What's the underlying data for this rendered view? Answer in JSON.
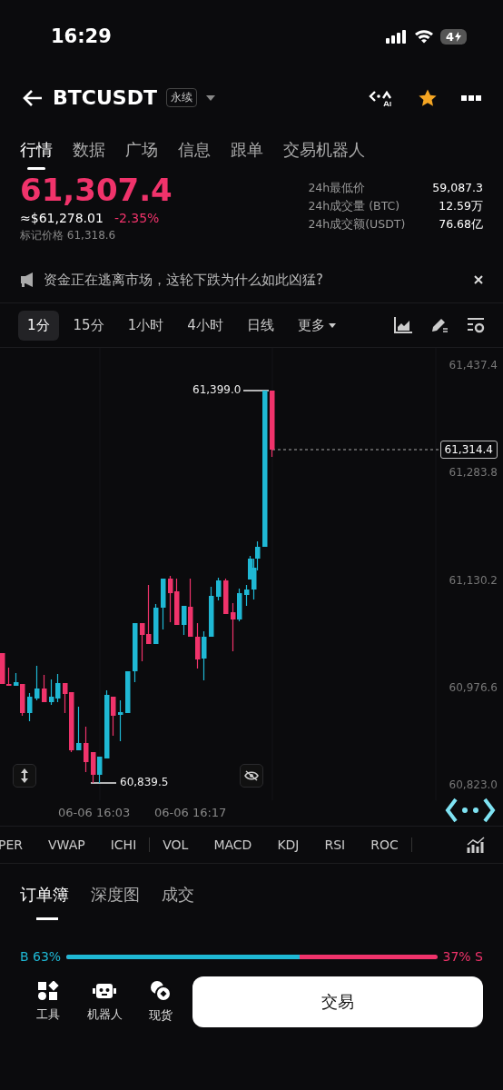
{
  "status_bar": {
    "time": "16:29",
    "battery": "4"
  },
  "header": {
    "symbol": "BTCUSDT",
    "badge": "永续"
  },
  "tabs": [
    {
      "label": "行情",
      "selected": true
    },
    {
      "label": "数据",
      "selected": false
    },
    {
      "label": "广场",
      "selected": false
    },
    {
      "label": "信息",
      "selected": false
    },
    {
      "label": "跟单",
      "selected": false
    },
    {
      "label": "交易机器人",
      "selected": false
    }
  ],
  "ticker": {
    "price": "61,307.4",
    "approx": "≈$61,278.01",
    "change": "-2.35%",
    "mark_price": "标记价格 61,318.6",
    "stats": [
      {
        "label": "24h最低价",
        "value": "59,087.3"
      },
      {
        "label": "24h成交量 (BTC)",
        "value": "12.59万"
      },
      {
        "label": "24h成交额(USDT)",
        "value": "76.68亿"
      }
    ]
  },
  "announcement": {
    "text": "资金正在逃离市场，这轮下跌为什么如此凶猛?"
  },
  "intervals": [
    {
      "label": "1分",
      "selected": true
    },
    {
      "label": "15分",
      "selected": false
    },
    {
      "label": "1小时",
      "selected": false
    },
    {
      "label": "4小时",
      "selected": false
    },
    {
      "label": "日线",
      "selected": false
    },
    {
      "label": "更多",
      "selected": false
    }
  ],
  "chart": {
    "yticks": [
      "61,437.4",
      "61,283.8",
      "61,130.2",
      "60,976.6",
      "60,823.0"
    ],
    "xticks": [
      "06-06 16:03",
      "06-06 16:17"
    ],
    "high": "61,399.0",
    "low": "60,839.5",
    "last": "61,314.4"
  },
  "indicators": [
    {
      "label": "PER",
      "divider_before": false
    },
    {
      "label": "VWAP",
      "divider_before": false
    },
    {
      "label": "ICHI",
      "divider_before": false
    },
    {
      "label": "VOL",
      "divider_before": true
    },
    {
      "label": "MACD",
      "divider_before": false
    },
    {
      "label": "KDJ",
      "divider_before": false
    },
    {
      "label": "RSI",
      "divider_before": false
    },
    {
      "label": "ROC",
      "divider_before": false
    }
  ],
  "book_tabs": [
    {
      "label": "订单簿",
      "selected": true
    },
    {
      "label": "深度图",
      "selected": false
    },
    {
      "label": "成交",
      "selected": false
    }
  ],
  "ratio": {
    "buy": "B 63%",
    "sell": "37% S",
    "level": 0.63
  },
  "bottom_bar": {
    "items": [
      {
        "label": "工具",
        "kind": "tools"
      },
      {
        "label": "机器人",
        "kind": "robot"
      },
      {
        "label": "现货",
        "kind": "spot"
      }
    ],
    "button": "交易"
  }
}
